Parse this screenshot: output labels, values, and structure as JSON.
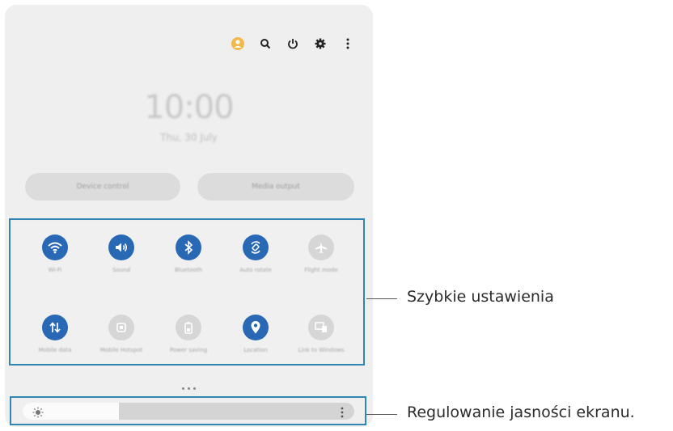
{
  "header": {
    "icons": [
      "account-icon",
      "search-icon",
      "power-icon",
      "settings-icon",
      "more-vertical-icon"
    ]
  },
  "lockscreen": {
    "time": "10:00",
    "date": "Thu, 30 July"
  },
  "buttons": {
    "device_control": "Device control",
    "media_output": "Media output"
  },
  "quick_settings": {
    "tiles": [
      {
        "label": "Wi-Fi",
        "icon": "wifi-icon",
        "state": "on"
      },
      {
        "label": "Sound",
        "icon": "sound-icon",
        "state": "on"
      },
      {
        "label": "Bluetooth",
        "icon": "bluetooth-icon",
        "state": "on"
      },
      {
        "label": "Auto rotate",
        "icon": "auto-rotate-icon",
        "state": "on"
      },
      {
        "label": "Flight mode",
        "icon": "airplane-icon",
        "state": "off"
      },
      {
        "label": "Mobile data",
        "icon": "mobile-data-icon",
        "state": "on"
      },
      {
        "label": "Mobile Hotspot",
        "icon": "hotspot-icon",
        "state": "off"
      },
      {
        "label": "Power saving",
        "icon": "battery-icon",
        "state": "off"
      },
      {
        "label": "Location",
        "icon": "location-icon",
        "state": "on"
      },
      {
        "label": "Link to Windows",
        "icon": "link-windows-icon",
        "state": "off"
      }
    ]
  },
  "brightness": {
    "level": 0.29
  },
  "callouts": {
    "quick_settings": "Szybkie ustawienia",
    "brightness": "Regulowanie jasności ekranu."
  },
  "colors": {
    "accent": "#2968b5",
    "frame": "#2f86b3",
    "account": "#f2b94a"
  }
}
